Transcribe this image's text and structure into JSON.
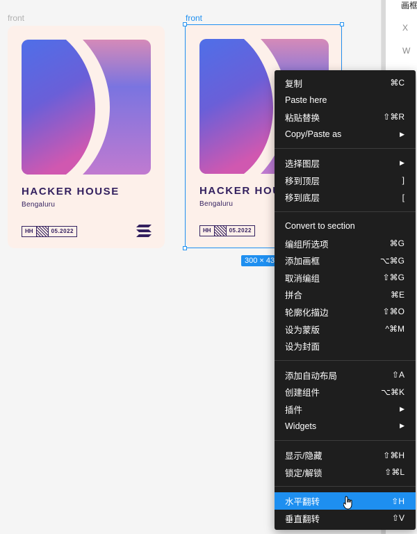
{
  "canvas": {
    "frames": [
      {
        "label": "front",
        "title": "HACKER  HOUSE",
        "subtitle": "Bengaluru",
        "badge_left": "HH",
        "badge_right": "05.2022"
      },
      {
        "label": "front",
        "title": "HACKER  HOUSE",
        "subtitle": "Bengaluru",
        "badge_left": "HH",
        "badge_right": "05.2022"
      }
    ],
    "selection_size": "300 × 43"
  },
  "right_panel": {
    "title": "画框",
    "x_label": "X",
    "w_label": "W"
  },
  "context_menu": {
    "groups": [
      [
        {
          "label": "复制",
          "shortcut": "⌘C"
        },
        {
          "label": "Paste here",
          "shortcut": ""
        },
        {
          "label": "粘贴替换",
          "shortcut": "⇧⌘R"
        },
        {
          "label": "Copy/Paste as",
          "shortcut": "▶"
        }
      ],
      [
        {
          "label": "选择图层",
          "shortcut": "▶"
        },
        {
          "label": "移到顶层",
          "shortcut": "]"
        },
        {
          "label": "移到底层",
          "shortcut": "["
        }
      ],
      [
        {
          "label": "Convert to section",
          "shortcut": ""
        },
        {
          "label": "编组所选项",
          "shortcut": "⌘G"
        },
        {
          "label": "添加画框",
          "shortcut": "⌥⌘G"
        },
        {
          "label": "取消编组",
          "shortcut": "⇧⌘G"
        },
        {
          "label": "拼合",
          "shortcut": "⌘E"
        },
        {
          "label": "轮廓化描边",
          "shortcut": "⇧⌘O"
        },
        {
          "label": "设为蒙版",
          "shortcut": "^⌘M"
        },
        {
          "label": "设为封面",
          "shortcut": ""
        }
      ],
      [
        {
          "label": "添加自动布局",
          "shortcut": "⇧A"
        },
        {
          "label": "创建组件",
          "shortcut": "⌥⌘K"
        },
        {
          "label": "插件",
          "shortcut": "▶"
        },
        {
          "label": "Widgets",
          "shortcut": "▶"
        }
      ],
      [
        {
          "label": "显示/隐藏",
          "shortcut": "⇧⌘H"
        },
        {
          "label": "锁定/解锁",
          "shortcut": "⇧⌘L"
        }
      ],
      [
        {
          "label": "水平翻转",
          "shortcut": "⇧H"
        },
        {
          "label": "垂直翻转",
          "shortcut": "⇧V"
        }
      ]
    ]
  },
  "colors": {
    "selection": "#1e8ff0",
    "menu_bg": "#1e1e1e",
    "card_bg": "#fdf0ea",
    "ink": "#33205f"
  }
}
